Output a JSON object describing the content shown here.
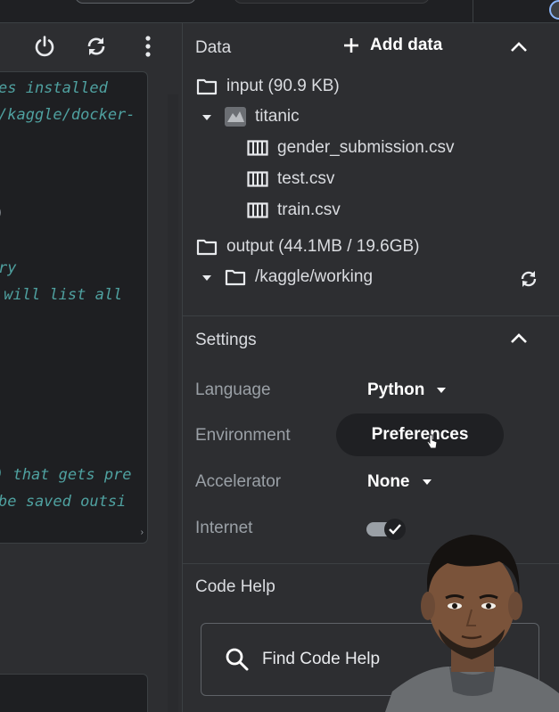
{
  "header": {
    "icons": [
      "power-icon",
      "refresh-icon",
      "more-vert-icon"
    ]
  },
  "code": {
    "lines": [
      "es installed",
      "/kaggle/docker-",
      ")",
      "ry",
      " will list all",
      ") that gets pre",
      "be saved outsi"
    ]
  },
  "data_panel": {
    "title": "Data",
    "add_data_label": "Add data",
    "input": {
      "label": "input (90.9 KB)",
      "dataset": "titanic",
      "files": [
        "gender_submission.csv",
        "test.csv",
        "train.csv"
      ]
    },
    "output": {
      "label": "output (44.1MB / 19.6GB)",
      "folder": "/kaggle/working"
    }
  },
  "settings": {
    "title": "Settings",
    "language_label": "Language",
    "language_value": "Python",
    "environment_label": "Environment",
    "environment_button": "Preferences",
    "accelerator_label": "Accelerator",
    "accelerator_value": "None",
    "internet_label": "Internet",
    "internet_enabled": true
  },
  "code_help": {
    "title": "Code Help",
    "search_label": "Find Code Help"
  },
  "colors": {
    "panel_bg": "#2d2e31",
    "code_text": "#4fa1a0",
    "label_text": "#9aa0a6",
    "value_text": "#ffffff"
  }
}
